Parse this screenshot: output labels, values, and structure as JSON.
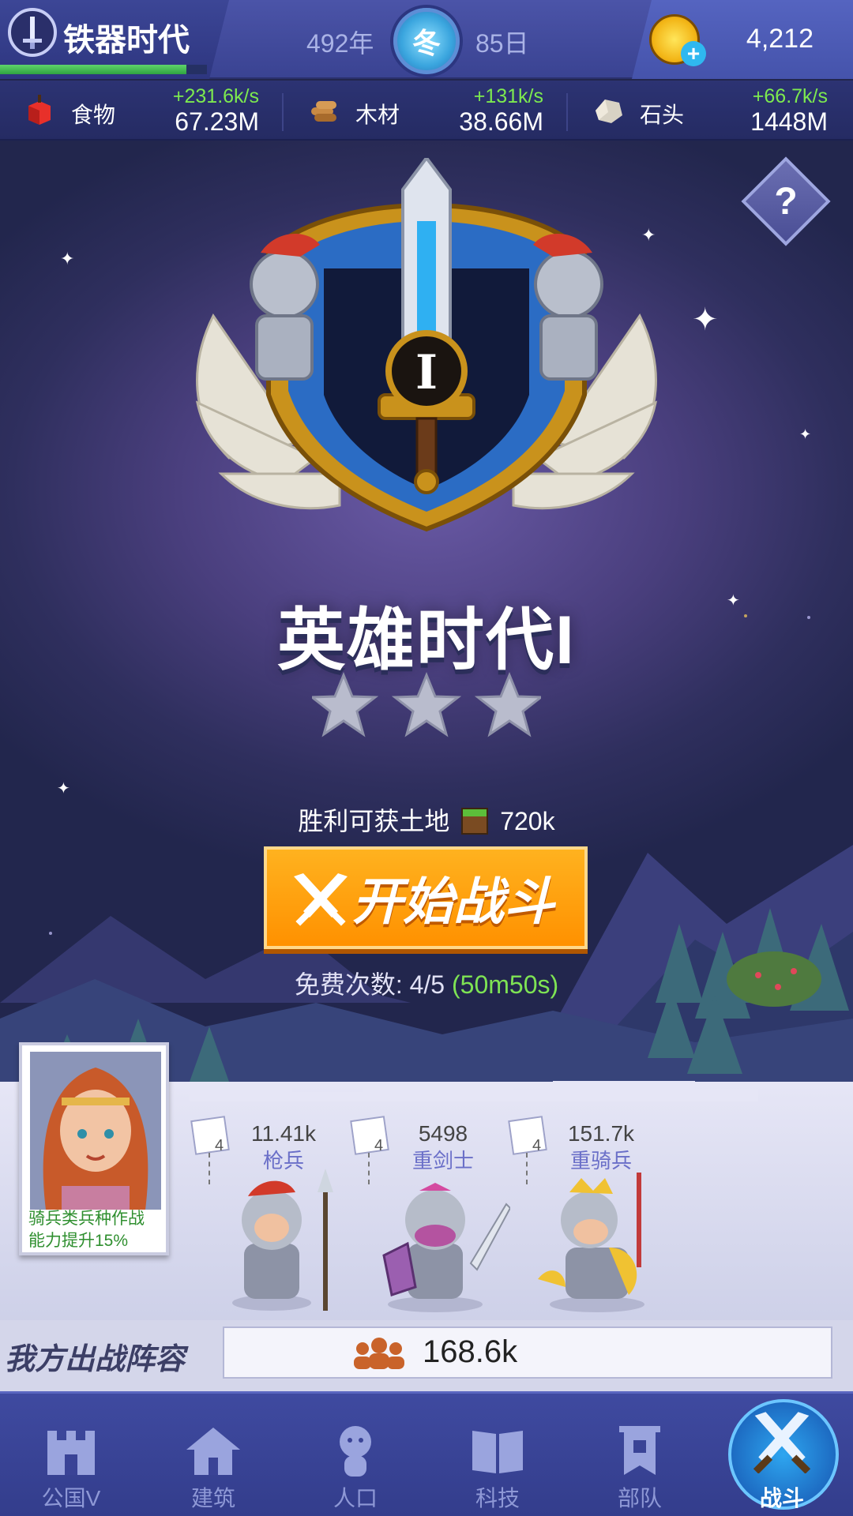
{
  "header": {
    "era_title": "铁器时代",
    "era_progress": 0.9,
    "year": "492年",
    "season": "冬",
    "day": "85日",
    "coins": "4,212",
    "coin_plus": "+"
  },
  "resources": [
    {
      "name": "食物",
      "icon": "apple-icon",
      "rate": "+231.6k/s",
      "value": "67.23M"
    },
    {
      "name": "木材",
      "icon": "wood-icon",
      "rate": "+131k/s",
      "value": "38.66M"
    },
    {
      "name": "石头",
      "icon": "stone-icon",
      "rate": "+66.7k/s",
      "value": "1448M"
    }
  ],
  "help": {
    "label": "?"
  },
  "emblem": {
    "numeral": "I"
  },
  "stage": {
    "title": "英雄时代I",
    "stars_earned": 0,
    "stars_total": 3
  },
  "reward": {
    "prefix": "胜利可获土地",
    "value": "720k"
  },
  "battle_button": {
    "label": "开始战斗"
  },
  "free_attempts": {
    "label": "免费次数: 4/5",
    "timer": "(50m50s)"
  },
  "hero": {
    "desc_line1": "骑兵类兵种作战",
    "desc_line2": "能力提升15%"
  },
  "units": [
    {
      "name": "枪兵",
      "power": "11.41k",
      "level": "4"
    },
    {
      "name": "重剑士",
      "power": "5498",
      "level": "4"
    },
    {
      "name": "重骑兵",
      "power": "151.7k",
      "level": "4"
    }
  ],
  "lineup": {
    "label": "我方出战阵容",
    "power": "168.6k"
  },
  "nav": [
    {
      "label": "公国V",
      "icon": "castle-icon"
    },
    {
      "label": "建筑",
      "icon": "house-icon"
    },
    {
      "label": "人口",
      "icon": "person-icon"
    },
    {
      "label": "科技",
      "icon": "book-icon"
    },
    {
      "label": "部队",
      "icon": "banner-icon"
    },
    {
      "label": "战斗",
      "icon": "crossed-swords-icon",
      "active": true
    }
  ],
  "colors": {
    "accent_orange": "#ff9a10",
    "rate_green": "#7dea4f",
    "hero_desc_green": "#2f8f2f",
    "unit_name_blue": "#6a6fc8"
  }
}
